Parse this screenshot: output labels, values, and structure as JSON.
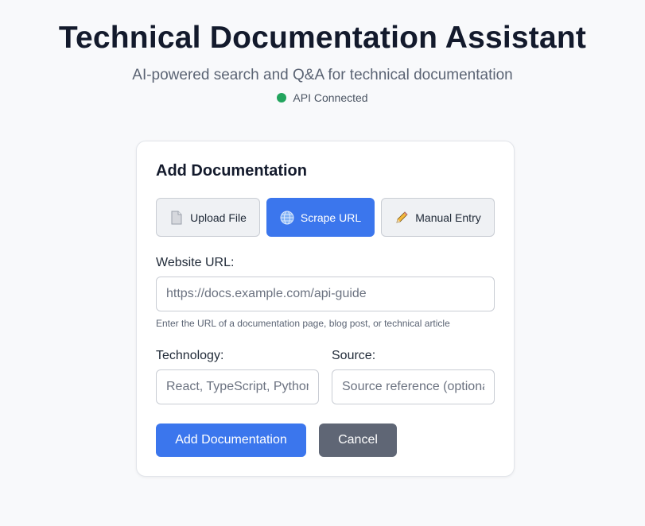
{
  "header": {
    "title": "Technical Documentation Assistant",
    "subtitle": "AI-powered search and Q&A for technical documentation",
    "status": "API Connected"
  },
  "card": {
    "title": "Add Documentation",
    "tabs": [
      {
        "label": "Upload File",
        "icon": "file-icon",
        "active": false
      },
      {
        "label": "Scrape URL",
        "icon": "globe-icon",
        "active": true
      },
      {
        "label": "Manual Entry",
        "icon": "pencil-icon",
        "active": false
      }
    ],
    "url_label": "Website URL:",
    "url_placeholder": "https://docs.example.com/api-guide",
    "url_help": "Enter the URL of a documentation page, blog post, or technical article",
    "technology_label": "Technology:",
    "technology_placeholder": "React, TypeScript, Python...",
    "source_label": "Source:",
    "source_placeholder": "Source reference (optional)",
    "add_button": "Add Documentation",
    "cancel_button": "Cancel"
  },
  "colors": {
    "accent": "#3b76ed",
    "status_ok": "#22a45d",
    "cancel": "#5f6675"
  }
}
